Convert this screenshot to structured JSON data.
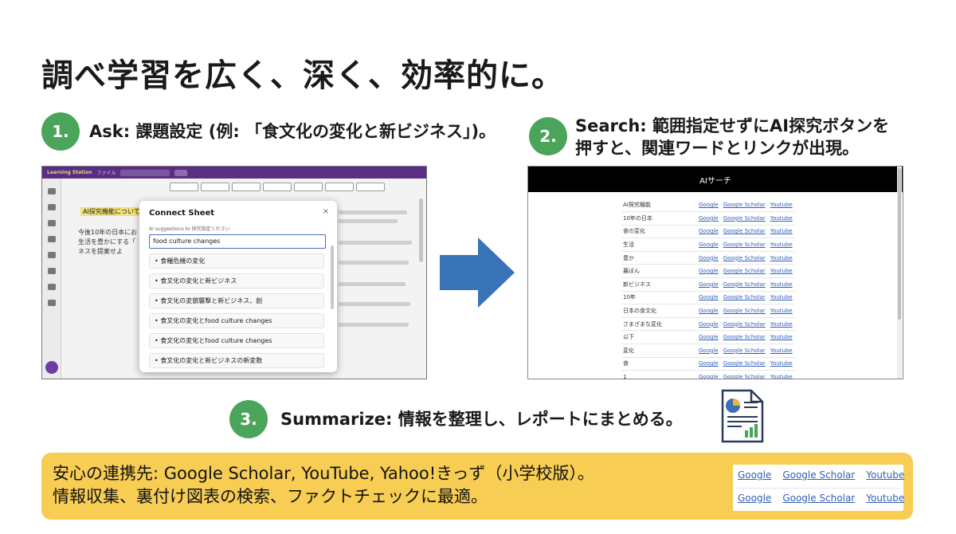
{
  "title": "調べ学習を広く、深く、効率的に。",
  "steps": [
    {
      "number": "1.",
      "text": "Ask: 課題設定 (例: 「食文化の変化と新ビジネス」)。"
    },
    {
      "number": "2.",
      "line1": "Search: 範囲指定せずにAI探究ボタンを",
      "line2": "押すと、関連ワードとリンクが出現。"
    },
    {
      "number": "3.",
      "text": "Summarize: 情報を整理し、レポートにまとめる。"
    }
  ],
  "app": {
    "logo": "Learning Station",
    "menu_file": "ファイル",
    "search_placeholder": "ファイルを検索",
    "highlight_text": "AI探究機能について",
    "doc_line1": "今後10年の日本にお",
    "doc_line2": "生活を豊かにする「",
    "doc_line3": "ネスを提案せよ",
    "dialog": {
      "title": "Connect Sheet",
      "close": "×",
      "subtitle": "AI suggestions to 探究指定ください",
      "input_value": "food culture changes",
      "suggestions": [
        "食糧危機の変化",
        "食文化の変化と新ビジネス",
        "食文化の変貌襲撃と新ビジネス、創",
        "食文化の変化とfood culture changes",
        "食文化の変化とfood culture changes",
        "食文化の変化と新ビジネスの新変数"
      ]
    }
  },
  "ai_search": {
    "header": "AIサーチ",
    "link_labels": [
      "Google",
      "Google Scholar",
      "Youtube"
    ],
    "words": [
      "AI探究機能",
      "10年の日本",
      "食の変化",
      "生活",
      "豊か",
      "暮ぼん",
      "新ビジネス",
      "10年",
      "日本の食文化",
      "さまざまな変化",
      "以下",
      "変化",
      "食",
      "1"
    ]
  },
  "bottom": {
    "line1": "安心の連携先: Google Scholar, YouTube, Yahoo!きっず（小学校版）。",
    "line2": "情報収集、裏付け図表の検索、ファクトチェックに最適。",
    "link_rows": [
      [
        "Google",
        "Google Scholar",
        "Youtube"
      ],
      [
        "Google",
        "Google Scholar",
        "Youtube"
      ]
    ]
  },
  "colors": {
    "step_green": "#4aa55a",
    "arrow_blue": "#3873b8",
    "band_yellow": "#f7cd54",
    "link_blue": "#2f5fb6",
    "app_purple": "#5b2e86"
  }
}
